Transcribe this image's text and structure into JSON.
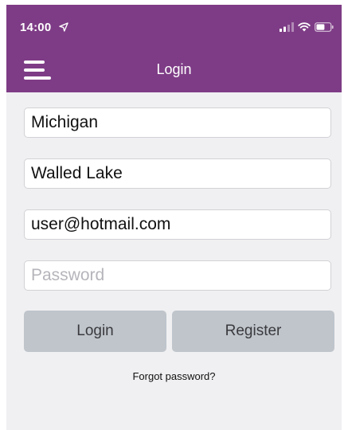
{
  "status_bar": {
    "time": "14:00"
  },
  "header": {
    "title": "Login",
    "menu_icon": "hamburger-menu-icon"
  },
  "form": {
    "state_value": "Michigan",
    "city_value": "Walled Lake",
    "email_value": "user@hotmail.com",
    "password_value": "",
    "password_placeholder": "Password"
  },
  "buttons": {
    "login_label": "Login",
    "register_label": "Register"
  },
  "links": {
    "forgot_password": "Forgot password?"
  },
  "colors": {
    "header_bg": "#7e3c86",
    "page_bg": "#f0f0f2",
    "button_bg": "#bfc5cb"
  }
}
